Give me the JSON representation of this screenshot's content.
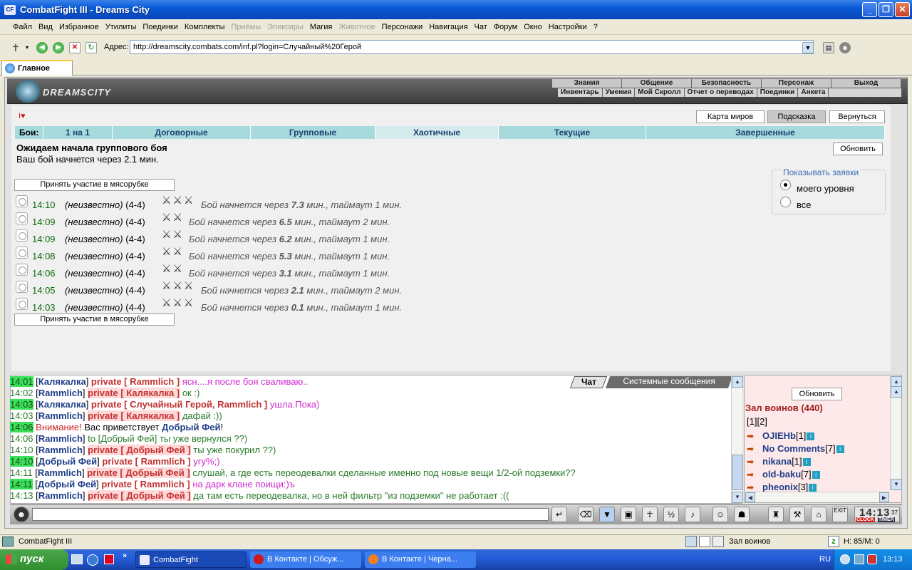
{
  "window": {
    "title": "CombatFight III - Dreams City",
    "icon_label": "CF"
  },
  "menu": [
    {
      "label": "Файл",
      "enabled": true
    },
    {
      "label": "Вид",
      "enabled": true
    },
    {
      "label": "Избранное",
      "enabled": true
    },
    {
      "label": "Утилиты",
      "enabled": true
    },
    {
      "label": "Поединки",
      "enabled": true
    },
    {
      "label": "Комплекты",
      "enabled": true
    },
    {
      "label": "Приёмы",
      "enabled": false
    },
    {
      "label": "Эликсиры",
      "enabled": false
    },
    {
      "label": "Магия",
      "enabled": true
    },
    {
      "label": "Животное",
      "enabled": false
    },
    {
      "label": "Персонажи",
      "enabled": true
    },
    {
      "label": "Навигация",
      "enabled": true
    },
    {
      "label": "Чат",
      "enabled": true
    },
    {
      "label": "Форум",
      "enabled": true
    },
    {
      "label": "Окно",
      "enabled": true
    },
    {
      "label": "Настройки",
      "enabled": true
    },
    {
      "label": "?",
      "enabled": true
    }
  ],
  "address": {
    "label": "Адрес:",
    "url": "http://dreamscity.combats.com/inf.pl?login=Случайный%20Герой"
  },
  "tab": {
    "label": "Главное"
  },
  "site": {
    "logo_text": "DREAMSCITY",
    "nav_top": [
      "Знания",
      "Общение",
      "Безопасность",
      "Персонаж",
      "Выход"
    ],
    "nav_bottom": [
      "Инвентарь",
      "Умения",
      "Мой Скролл",
      "Отчет о переводах",
      "Поединки",
      "Анкета"
    ]
  },
  "buttons": {
    "world_map": "Карта миров",
    "hint": "Подсказка",
    "back": "Вернуться",
    "refresh": "Обновить",
    "join": "Принять участие в мясорубке"
  },
  "battle_tabs": {
    "label": "Бои:",
    "items": [
      "1 на 1",
      "Договорные",
      "Групповые",
      "Хаотичные",
      "Текущие",
      "Завершенные"
    ],
    "active": "Хаотичные"
  },
  "waiting": {
    "title": "Ожидаем начала группового боя",
    "subtitle": "Ваш бой начнется через 2.1 мин."
  },
  "filter": {
    "title": "Показывать заявки",
    "options": [
      "моего уровня",
      "все"
    ],
    "selected": "моего уровня"
  },
  "battles": [
    {
      "time": "14:10",
      "who": "(неизвестно)",
      "level": "(4-4)",
      "prefix": "Бой начнется через",
      "minutes": "7.3",
      "suffix": "мин., таймаут 1 мин.",
      "icons": "⚔⚔⚔"
    },
    {
      "time": "14:09",
      "who": "(неизвестно)",
      "level": "(4-4)",
      "prefix": "Бой начнется через",
      "minutes": "6.5",
      "suffix": "мин., таймаут 2 мин.",
      "icons": "⚔⚔"
    },
    {
      "time": "14:09",
      "who": "(неизвестно)",
      "level": "(4-4)",
      "prefix": "Бой начнется через",
      "minutes": "6.2",
      "suffix": "мин., таймаут 1 мин.",
      "icons": "⚔⚔"
    },
    {
      "time": "14:08",
      "who": "(неизвестно)",
      "level": "(4-4)",
      "prefix": "Бой начнется через",
      "minutes": "5.3",
      "suffix": "мин., таймаут 1 мин.",
      "icons": "⚔⚔"
    },
    {
      "time": "14:06",
      "who": "(неизвестно)",
      "level": "(4-4)",
      "prefix": "Бой начнется через",
      "minutes": "3.1",
      "suffix": "мин., таймаут 1 мин.",
      "icons": "⚔⚔"
    },
    {
      "time": "14:05",
      "who": "(неизвестно)",
      "level": "(4-4)",
      "prefix": "Бой начнется через",
      "minutes": "2.1",
      "suffix": "мин., таймаут 2 мин.",
      "icons": "⚔⚔⚔"
    },
    {
      "time": "14:03",
      "who": "(неизвестно)",
      "level": "(4-4)",
      "prefix": "Бой начнется через",
      "minutes": "0.1",
      "suffix": "мин., таймаут 1 мин.",
      "icons": "⚔⚔⚔"
    }
  ],
  "chat_tabs": [
    "Чат",
    "Системные сообщения"
  ],
  "chat": [
    {
      "time": "14:01",
      "hl": true,
      "from": "Калякалка",
      "kind": "private",
      "to": "Rammlich",
      "text": "ясн....я после боя сваливаю..",
      "color": "#d02ad0"
    },
    {
      "time": "14:02",
      "hl": false,
      "from": "Rammlich",
      "kind": "private",
      "to": "Калякалка",
      "text": "ок :)",
      "color": "#2a7a2a"
    },
    {
      "time": "14:03",
      "hl": true,
      "from": "Калякалка",
      "kind": "private",
      "to": "Случайный Герой, Rammlich",
      "text": "ушла.Пока)",
      "color": "#d02ad0"
    },
    {
      "time": "14:03",
      "hl": false,
      "from": "Rammlich",
      "kind": "private",
      "to": "Калякалка",
      "text": "дафай :))",
      "color": "#2a7a2a"
    },
    {
      "time": "14:06",
      "hl": true,
      "system": true,
      "warn": "Внимание!",
      "text1": "Вас приветствует",
      "name": "Добрый Фей",
      "text2": "!"
    },
    {
      "time": "14:06",
      "hl": false,
      "from": "Rammlich",
      "kind": "to",
      "to": "Добрый Фей",
      "text": "ты уже вернулся ??)",
      "color": "#2a7a2a"
    },
    {
      "time": "14:10",
      "hl": false,
      "from": "Rammlich",
      "kind": "private",
      "to": "Добрый Фей",
      "text": "ты уже покурил ??)",
      "color": "#2a7a2a"
    },
    {
      "time": "14:10",
      "hl": true,
      "from": "Добрый Фей",
      "kind": "private",
      "to": "Rammlich",
      "text": "угу%;)",
      "color": "#d02ad0"
    },
    {
      "time": "14:11",
      "hl": false,
      "from": "Rammlich",
      "kind": "private",
      "to": "Добрый Фей",
      "text": "слушай, а где есть переодевалки сделанные именно под новые вещи 1/2-ой подземки??",
      "color": "#2a7a2a"
    },
    {
      "time": "14:11",
      "hl": true,
      "from": "Добрый Фей",
      "kind": "private",
      "to": "Rammlich",
      "text": "на дарк клане поищи:)ъ",
      "color": "#d02ad0"
    },
    {
      "time": "14:13",
      "hl": false,
      "from": "Rammlich",
      "kind": "private",
      "to": "Добрый Фей",
      "text": "да там есть переодевалка, но в ней фильтр \"из подземки\" не работает :((",
      "color": "#2a7a2a"
    }
  ],
  "room": {
    "refresh": "Обновить",
    "title": "Зал воинов (440)",
    "pages": "[1][2]",
    "players": [
      {
        "name": "OJIEHb",
        "level": "[1]"
      },
      {
        "name": "No Comments",
        "level": "[7]"
      },
      {
        "name": "nikana",
        "level": "[1]"
      },
      {
        "name": "old-baku",
        "level": "[7]"
      },
      {
        "name": "pheonix",
        "level": "[3]"
      }
    ]
  },
  "clock": {
    "time": "14:13",
    "seconds": "37",
    "label1": "CLOCK",
    "label2": "TIMER"
  },
  "status": {
    "left": "CombatFight III",
    "room": "Зал воинов",
    "stats": "Н: 85/М: 0"
  },
  "taskbar": {
    "start": "пуск",
    "tasks": [
      "CombatFight",
      "В Контакте | Обсуж...",
      "В Контакте | Черна..."
    ],
    "lang": "RU",
    "time": "13:13"
  }
}
